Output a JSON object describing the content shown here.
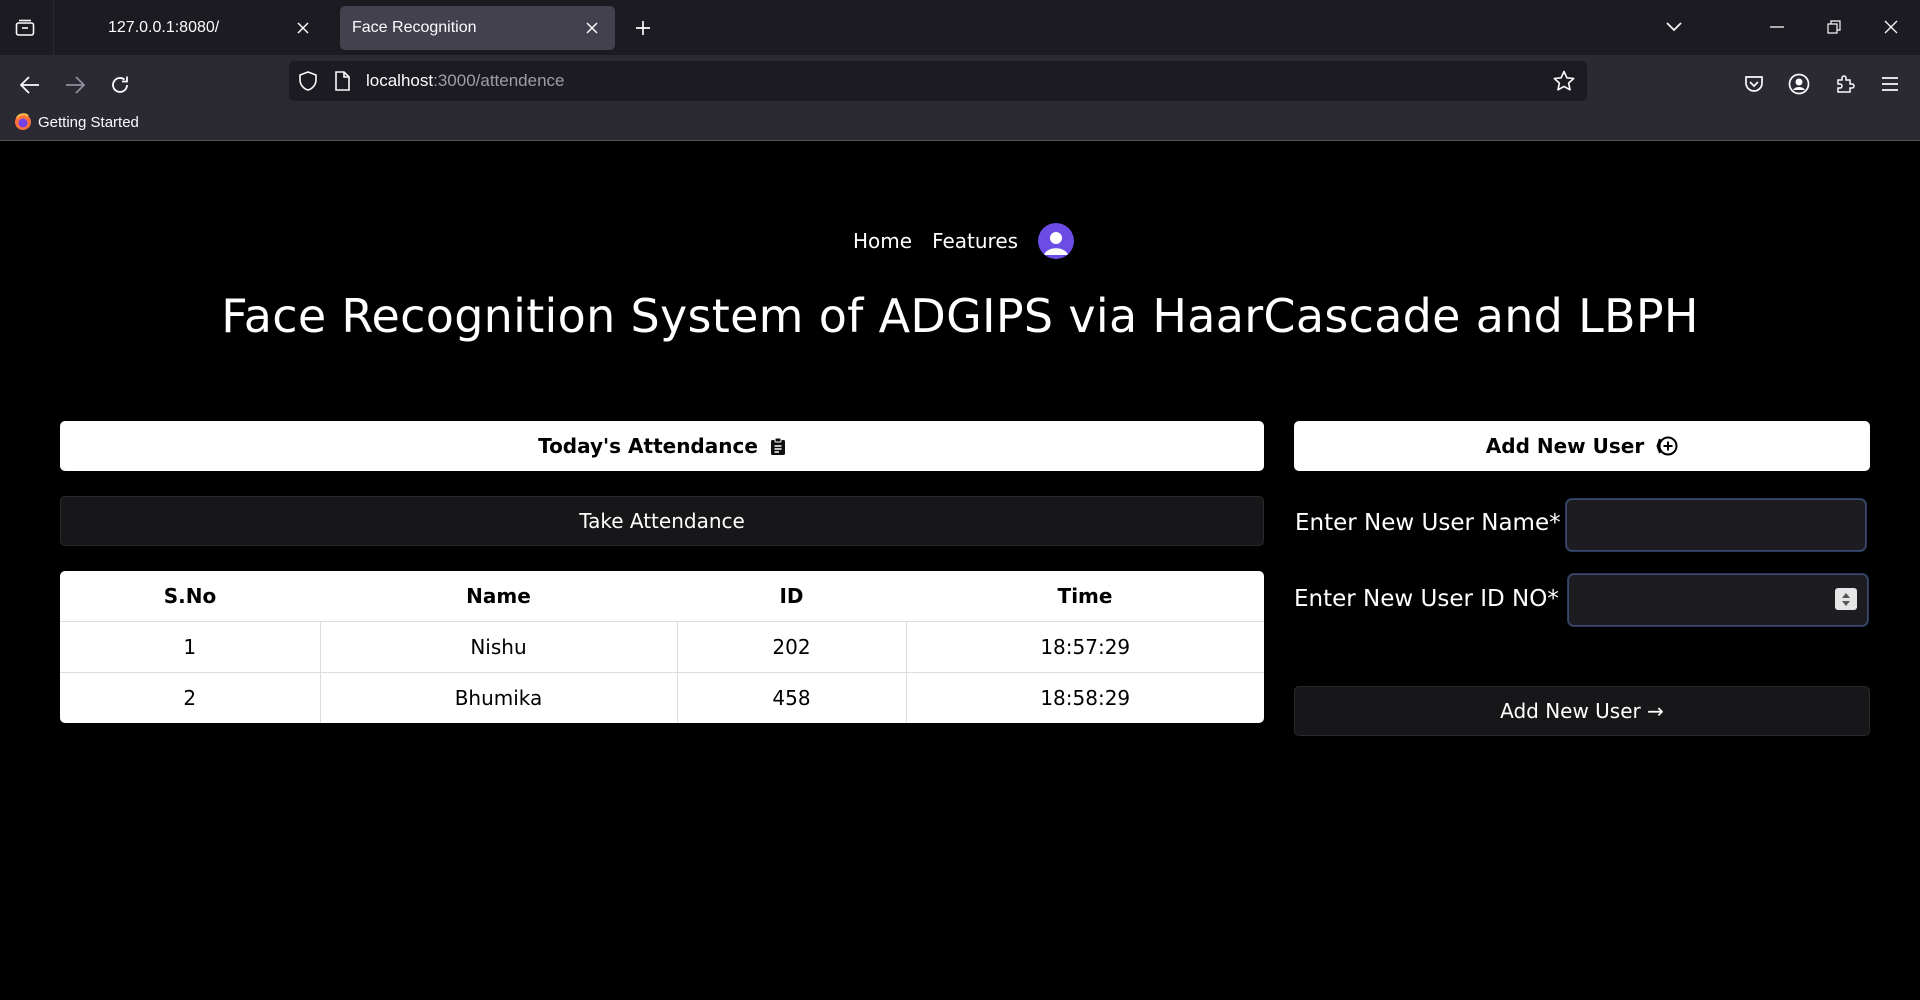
{
  "browser": {
    "tabs": [
      {
        "title": "127.0.0.1:8080/",
        "active": false
      },
      {
        "title": "Face Recognition",
        "active": true
      }
    ],
    "url": {
      "host": "localhost",
      "path": ":3000/attendence"
    },
    "bookmarks": [
      {
        "label": "Getting Started"
      }
    ]
  },
  "nav": {
    "links": [
      "Home",
      "Features"
    ]
  },
  "title": "Face Recognition System of ADGIPS via HaarCascade and LBPH",
  "attendance": {
    "header_label": "Today's Attendance",
    "take_button": "Take Attendance",
    "columns": [
      "S.No",
      "Name",
      "ID",
      "Time"
    ],
    "rows": [
      [
        "1",
        "Nishu",
        "202",
        "18:57:29"
      ],
      [
        "2",
        "Bhumika",
        "458",
        "18:58:29"
      ]
    ]
  },
  "add_user": {
    "header_label": "Add New User",
    "name_label": "Enter New User Name*",
    "id_label": "Enter New User ID NO*",
    "name_value": "",
    "id_value": "",
    "submit_label": "Add New User →"
  },
  "colors": {
    "avatar": "#6b4de6",
    "chrome_dark": "#1c1b22",
    "chrome_mid": "#2b2a33",
    "input_border": "#3a4a6e"
  }
}
